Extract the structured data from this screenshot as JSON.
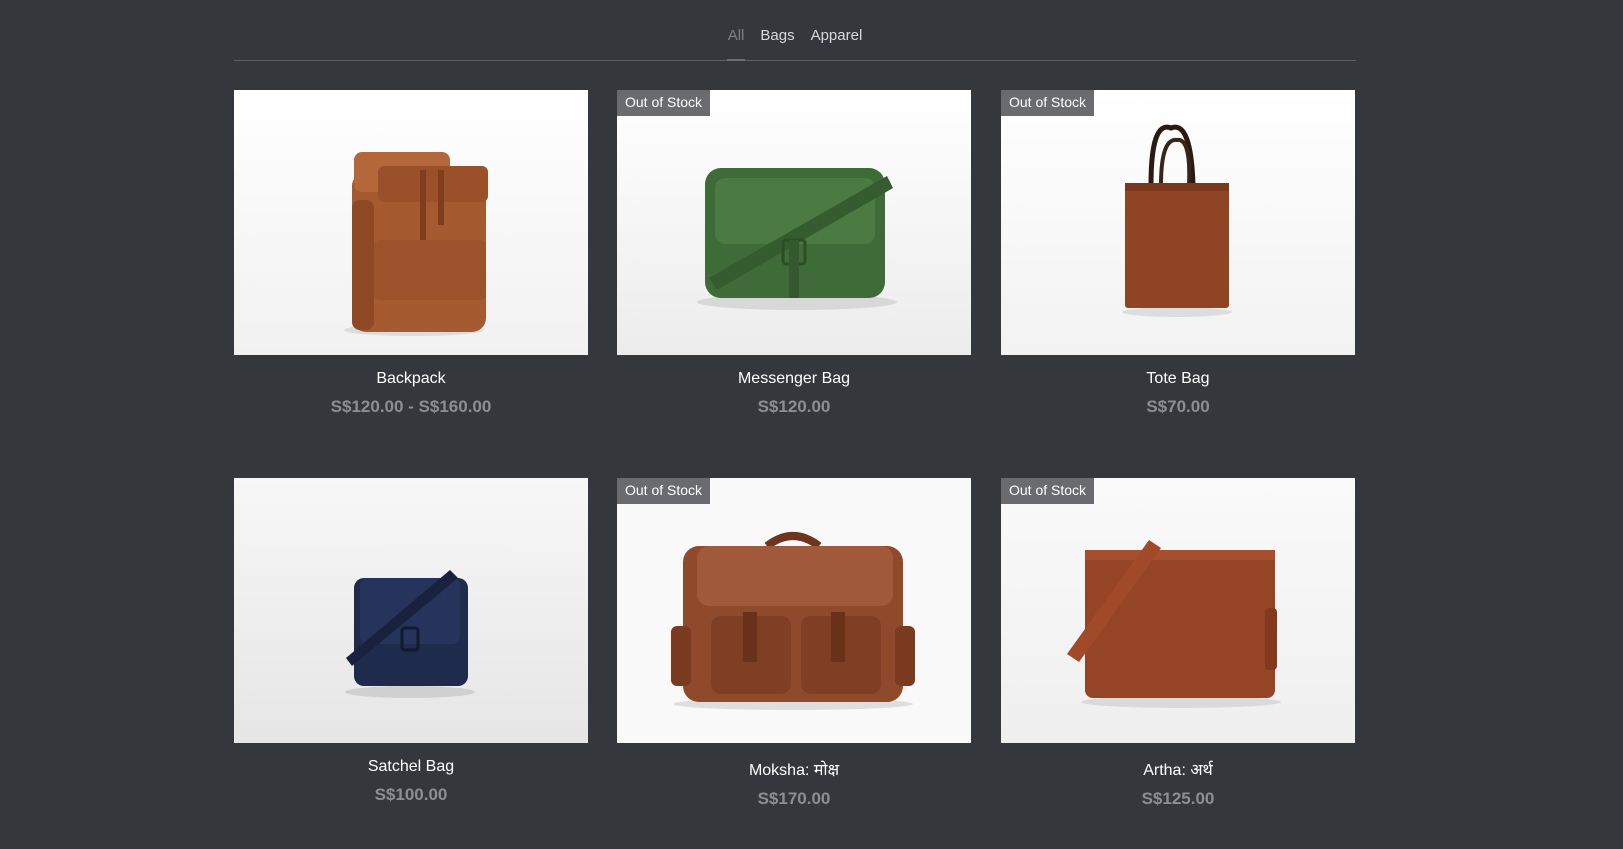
{
  "filters": {
    "items": [
      {
        "label": "All",
        "active": true
      },
      {
        "label": "Bags",
        "active": false
      },
      {
        "label": "Apparel",
        "active": false
      }
    ]
  },
  "products": [
    {
      "name": "Backpack",
      "price": "S$120.00 - S$160.00",
      "badge": "",
      "bag_color": "#a65a30",
      "icon": "backpack-image"
    },
    {
      "name": "Messenger Bag",
      "price": "S$120.00",
      "badge": "Out of Stock",
      "bag_color": "#3f6b38",
      "icon": "messenger-bag-image"
    },
    {
      "name": "Tote Bag",
      "price": "S$70.00",
      "badge": "Out of Stock",
      "bag_color": "#8f4523",
      "icon": "tote-bag-image"
    },
    {
      "name": "Satchel Bag",
      "price": "S$100.00",
      "badge": "",
      "bag_color": "#1f2b4d",
      "icon": "satchel-bag-image"
    },
    {
      "name": "Moksha: मोक्ष",
      "price": "S$170.00",
      "badge": "Out of Stock",
      "bag_color": "#8f4a2c",
      "icon": "moksha-bag-image"
    },
    {
      "name": "Artha: अर्थ",
      "price": "S$125.00",
      "badge": "Out of Stock",
      "bag_color": "#964426",
      "icon": "artha-bag-image"
    }
  ],
  "colors": {
    "background": "#34373c",
    "badge": "#6a6b6e",
    "price": "#8c8e92"
  }
}
